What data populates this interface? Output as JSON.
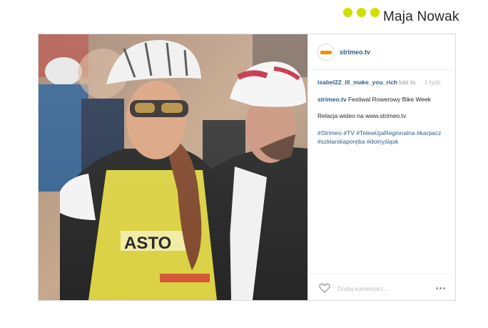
{
  "slide": {
    "author": "Maja Nowak",
    "accent_color": "#cfe000"
  },
  "post": {
    "account": "strimeo.tv",
    "avatar_icon": "strimeo-logo",
    "likes": {
      "user": "isabel22_ill_make_you_rich",
      "text": "lubi to.",
      "time": "1 tydz."
    },
    "caption": {
      "user": "strimeo.tv",
      "text": "Festiwal Rowerowy Bike Week"
    },
    "comment_line": "Relacja wideo na www.strimeo.tv",
    "hashtags": "#Strimeo #TV #TelewizjaRegionalna #karpacz #szklarskaporęba #dolnyśląsk",
    "add_comment_placeholder": "Dodaj komentarz...",
    "icons": {
      "like": "heart-icon",
      "options": "more-icon"
    }
  }
}
